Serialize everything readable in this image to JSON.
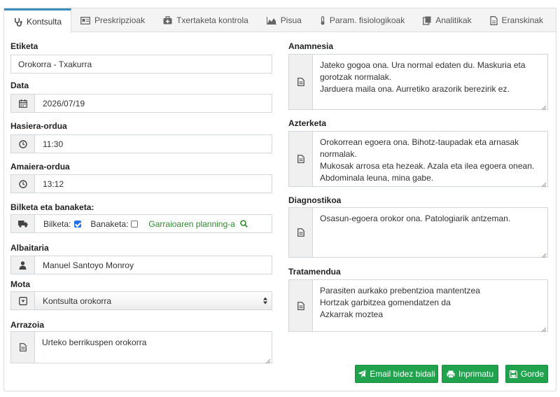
{
  "tabs": [
    {
      "label": "Kontsulta",
      "icon": "stethoscope-icon",
      "active": true
    },
    {
      "label": "Preskripzioak",
      "icon": "card-icon",
      "active": false
    },
    {
      "label": "Txertaketa kontrola",
      "icon": "medkit-icon",
      "active": false
    },
    {
      "label": "Pisua",
      "icon": "area-chart-icon",
      "active": false
    },
    {
      "label": "Param. fisiologikoak",
      "icon": "thermometer-icon",
      "active": false
    },
    {
      "label": "Analitikak",
      "icon": "clipboard-icon",
      "active": false
    },
    {
      "label": "Eranskinak",
      "icon": "file-icon",
      "active": false
    }
  ],
  "left": {
    "etiketa": {
      "label": "Etiketa",
      "value": "Orokorra - Txakurra"
    },
    "data": {
      "label": "Data",
      "value": "2026/07/19"
    },
    "hasiera": {
      "label": "Hasiera-ordua",
      "value": "11:30"
    },
    "amaiera": {
      "label": "Amaiera-ordua",
      "value": "13:12"
    },
    "bilketa": {
      "label": "Bilketa eta banaketa:",
      "bilketa_label": "Bilketa:",
      "bilketa_checked": true,
      "banaketa_label": "Banaketa:",
      "banaketa_checked": false,
      "link": "Garraioaren planning-a"
    },
    "albaitaria": {
      "label": "Albaitaria",
      "value": "Manuel Santoyo Monroy"
    },
    "mota": {
      "label": "Mota",
      "value": "Kontsulta orokorra"
    },
    "arrazoia": {
      "label": "Arrazoia",
      "value": "Urteko berrikuspen orokorra"
    }
  },
  "right": {
    "anamnesia": {
      "label": "Anamnesia",
      "text": "Jateko gogoa ona. Ura normal edaten du. Maskuria eta gorotzak normalak.\nJarduera maila ona. Aurretiko arazorik berezirik ez."
    },
    "azterketa": {
      "label": "Azterketa",
      "text": "Orokorrean egoera ona. Bihotz-taupadak eta arnasak normalak.\nMukosak arrosa eta hezeak. Azala eta ilea egoera onean.\nAbdominala leuna, mina gabe."
    },
    "diagnostikoa": {
      "label": "Diagnostikoa",
      "text": "Osasun-egoera orokor ona. Patologiarik antzeman."
    },
    "tratamendua": {
      "label": "Tratamendua",
      "text": "Parasiten aurkako prebentzioa mantentzea\nHortzak garbitzea gomendatzen da\nAzkarrak moztea"
    }
  },
  "buttons": {
    "email": "Email bidez bidali",
    "print": "Inprimatu",
    "save": "Gorde"
  },
  "colors": {
    "tab_active_border": "#3c8dbc",
    "button_green": "#21a34d",
    "link_green": "#2f8a2f",
    "checkbox_blue": "#1e73e8"
  }
}
